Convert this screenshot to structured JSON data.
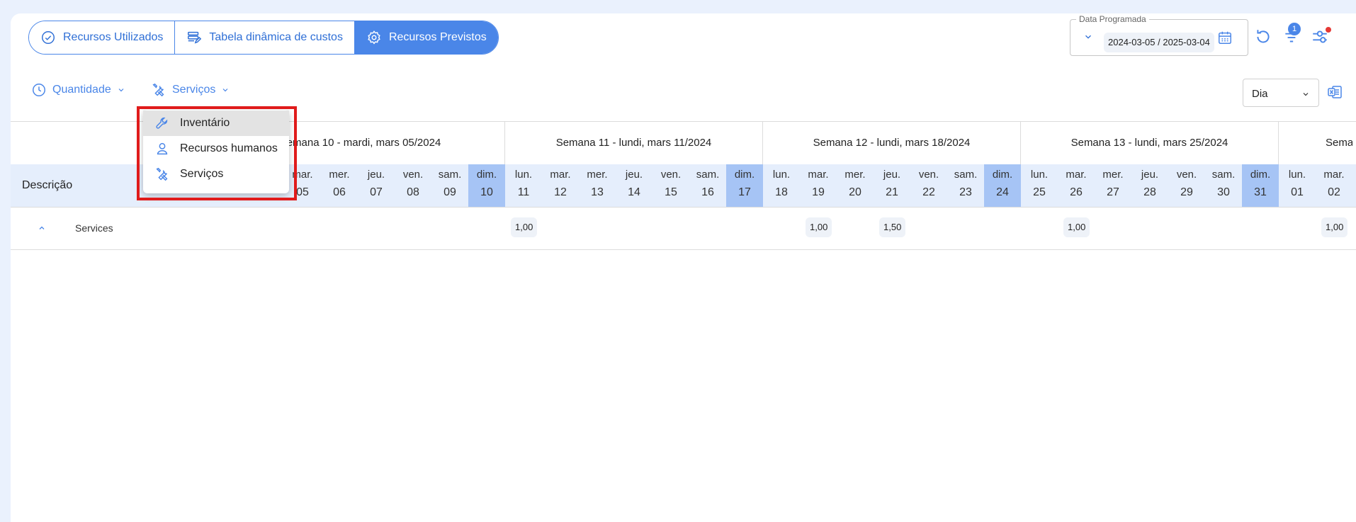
{
  "tabs": [
    {
      "label": "Recursos Utilizados",
      "icon": "check-circle-icon",
      "active": false
    },
    {
      "label": "Tabela dinâmica de custos",
      "icon": "table-edit-icon",
      "active": false
    },
    {
      "label": "Recursos Previstos",
      "icon": "gear-icon",
      "active": true
    }
  ],
  "date_filter": {
    "legend": "Data Programada",
    "value": "2024-03-05 / 2025-03-04"
  },
  "filter_badge": "1",
  "toolbar": {
    "quantity_label": "Quantidade",
    "services_label": "Serviços",
    "period_value": "Dia"
  },
  "menu": {
    "items": [
      "Inventário",
      "Recursos humanos",
      "Serviços"
    ]
  },
  "grid": {
    "description_header": "Descrição",
    "weeks": [
      "Semana 10 - mardi, mars 05/2024",
      "Semana 11 - lundi, mars 11/2024",
      "Semana 12 - lundi, mars 18/2024",
      "Semana 13 - lundi, mars 25/2024",
      "Sema"
    ],
    "days": [
      {
        "name": "mar.",
        "num": "05"
      },
      {
        "name": "mer.",
        "num": "06"
      },
      {
        "name": "jeu.",
        "num": "07"
      },
      {
        "name": "ven.",
        "num": "08"
      },
      {
        "name": "sam.",
        "num": "09"
      },
      {
        "name": "dim.",
        "num": "10"
      },
      {
        "name": "lun.",
        "num": "11"
      },
      {
        "name": "mar.",
        "num": "12"
      },
      {
        "name": "mer.",
        "num": "13"
      },
      {
        "name": "jeu.",
        "num": "14"
      },
      {
        "name": "ven.",
        "num": "15"
      },
      {
        "name": "sam.",
        "num": "16"
      },
      {
        "name": "dim.",
        "num": "17"
      },
      {
        "name": "lun.",
        "num": "18"
      },
      {
        "name": "mar.",
        "num": "19"
      },
      {
        "name": "mer.",
        "num": "20"
      },
      {
        "name": "jeu.",
        "num": "21"
      },
      {
        "name": "ven.",
        "num": "22"
      },
      {
        "name": "sam.",
        "num": "23"
      },
      {
        "name": "dim.",
        "num": "24"
      },
      {
        "name": "lun.",
        "num": "25"
      },
      {
        "name": "mar.",
        "num": "26"
      },
      {
        "name": "mer.",
        "num": "27"
      },
      {
        "name": "jeu.",
        "num": "28"
      },
      {
        "name": "ven.",
        "num": "29"
      },
      {
        "name": "sam.",
        "num": "30"
      },
      {
        "name": "dim.",
        "num": "31"
      },
      {
        "name": "lun.",
        "num": "01"
      },
      {
        "name": "mar.",
        "num": "02"
      }
    ],
    "row": {
      "label": "Services",
      "values": {
        "11": "1,00",
        "19": "1,00",
        "21": "1,50",
        "26": "1,00",
        "02": "1,00"
      }
    }
  },
  "colors": {
    "accent": "#4a86e8",
    "sunday": "#a6c4f5",
    "highlight_box": "#e01b1b"
  }
}
